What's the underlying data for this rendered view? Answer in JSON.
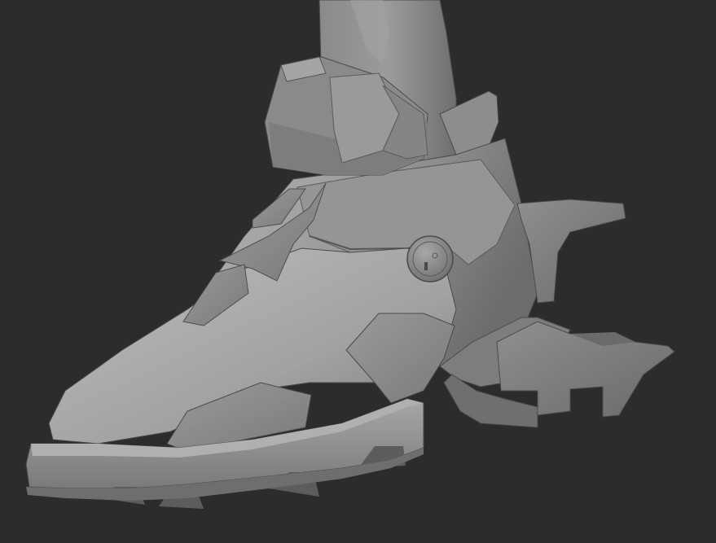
{
  "scene": {
    "subject": "boot-sculpt",
    "colors": {
      "background": "#2c2c2c",
      "clay_light": "#a9a9a9",
      "clay_mid": "#8e8e8e",
      "clay_dark": "#6f6f6f",
      "clay_shadow": "#4a4a4a",
      "outline": "#3e3e3e"
    }
  }
}
